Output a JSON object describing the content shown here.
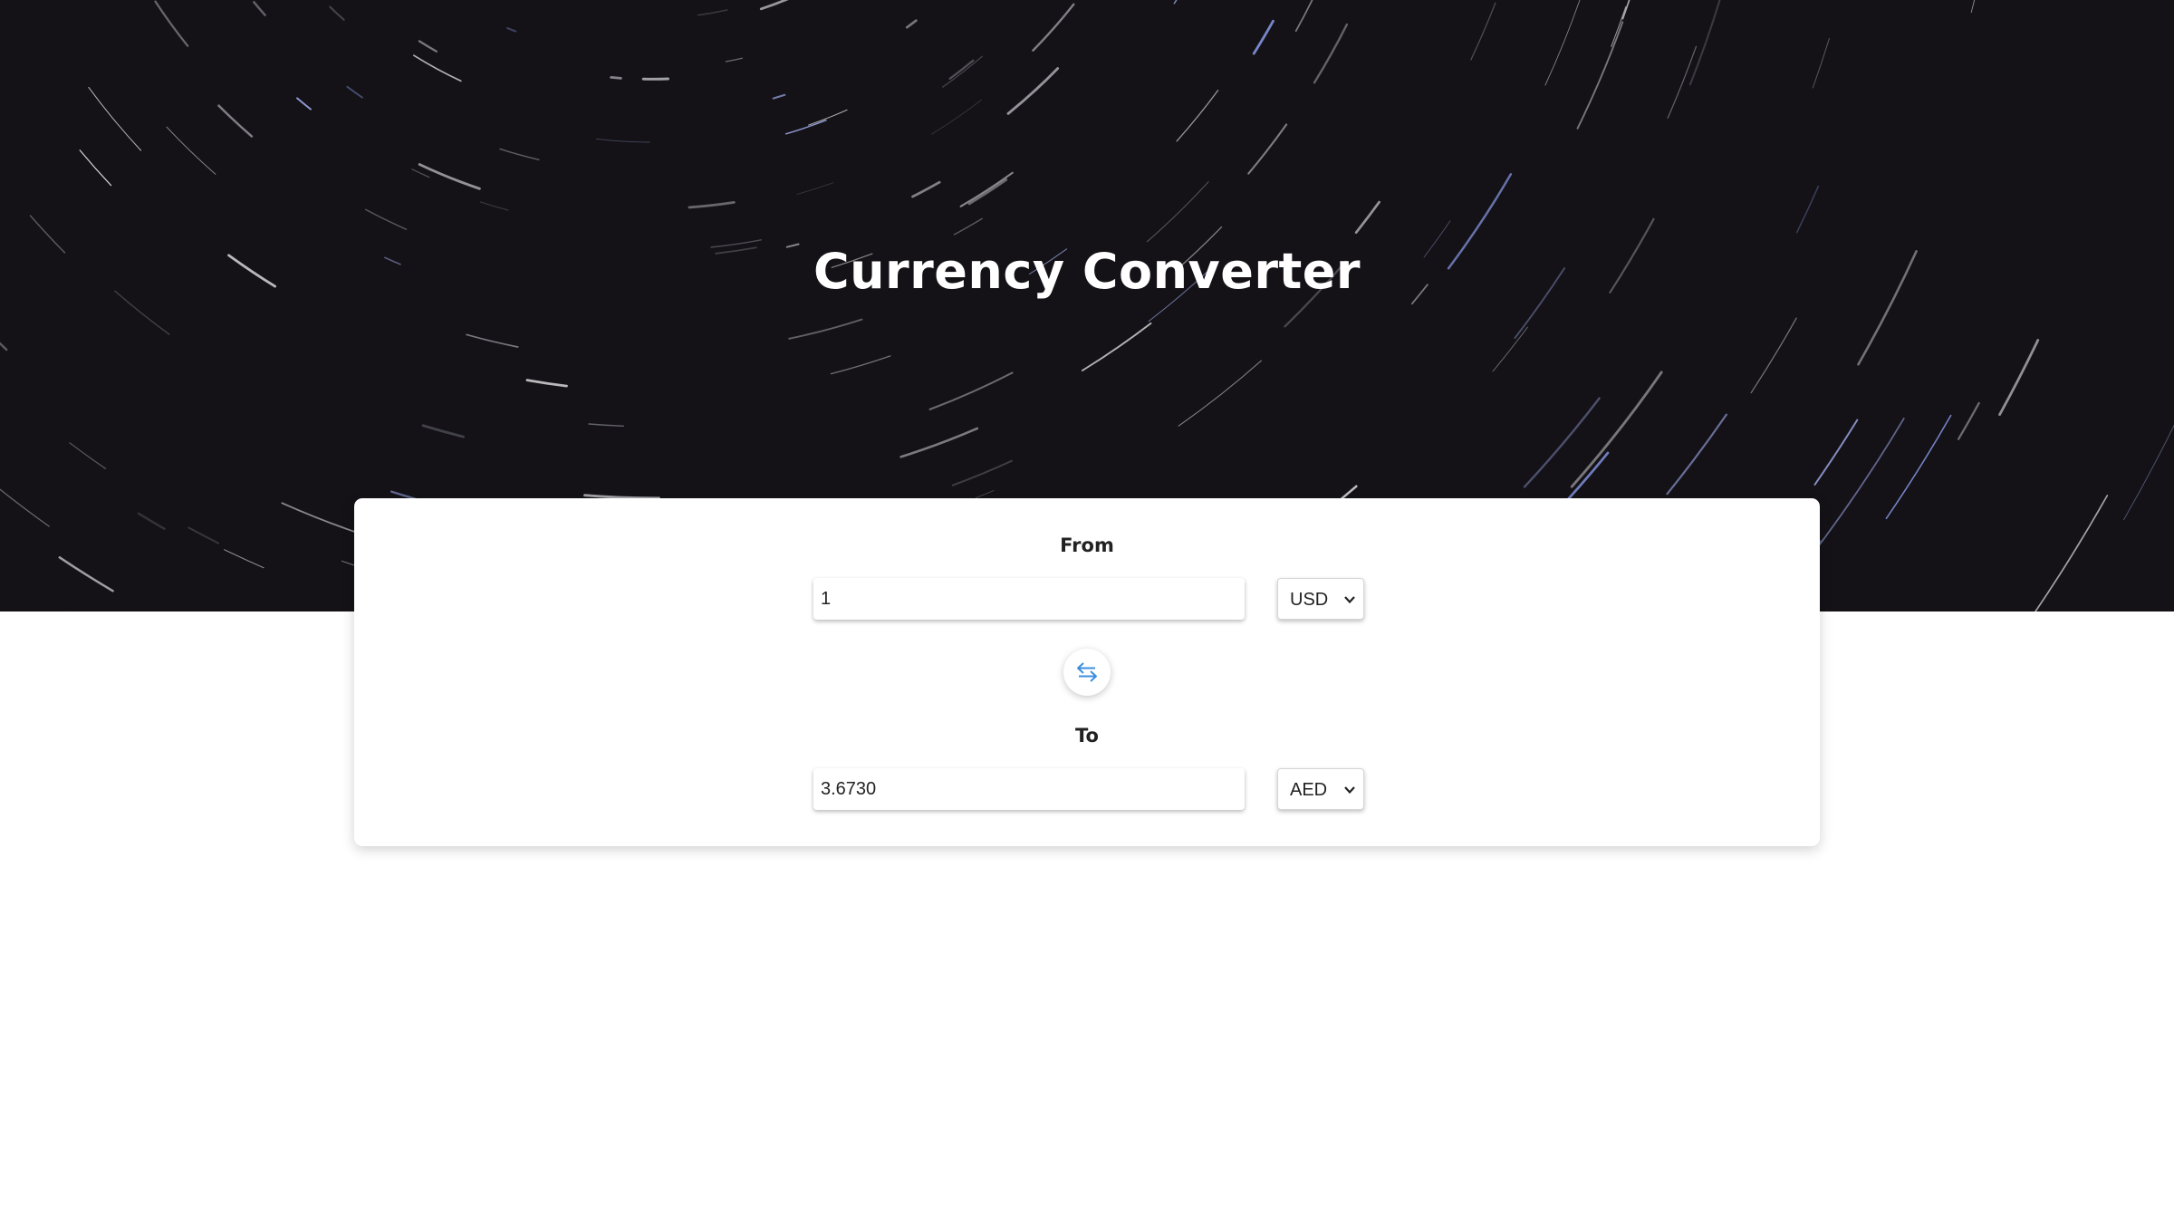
{
  "header": {
    "title": "Currency Converter"
  },
  "converter": {
    "from": {
      "label": "From",
      "amount": "1",
      "currency": "USD"
    },
    "to": {
      "label": "To",
      "amount": "3.6730",
      "currency": "AED"
    },
    "swap_icon": "swap-arrows-icon",
    "chevron_icon": "chevron-down-icon"
  },
  "colors": {
    "hero_background": "#141216",
    "swap_icon": "#3b8fe0",
    "card_background": "#ffffff"
  }
}
